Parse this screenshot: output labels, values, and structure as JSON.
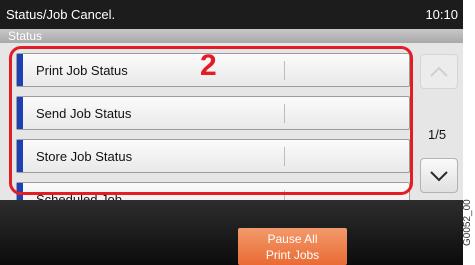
{
  "header": {
    "title": "Status/Job Cancel.",
    "clock": "10:10"
  },
  "subheader": {
    "label": "Status"
  },
  "callout": "2",
  "menu": {
    "items": [
      {
        "label": "Print Job Status"
      },
      {
        "label": "Send Job Status"
      },
      {
        "label": "Store Job Status"
      },
      {
        "label": "Scheduled Job"
      }
    ]
  },
  "pagination": {
    "indicator": "1/5"
  },
  "footer": {
    "pause_line1": "Pause All",
    "pause_line2": "Print Jobs"
  },
  "watermark": "G0052_00",
  "colors": {
    "accent": "#e41d25",
    "marker": "#1f3fb5",
    "pause_button": "#ee7f4a"
  }
}
